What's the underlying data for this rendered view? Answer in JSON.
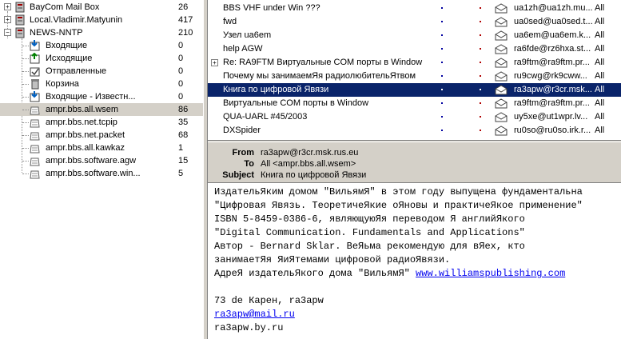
{
  "tree": [
    {
      "name": "BayCom Mail Box",
      "count": "26",
      "icon": "server-icon",
      "expand": "+"
    },
    {
      "name": "Local.Vladimir.Matyunin",
      "count": "417",
      "icon": "server-icon",
      "expand": "+"
    },
    {
      "name": "NEWS-NNTP",
      "count": "210",
      "icon": "server-icon",
      "expand": "−"
    },
    {
      "name": "Входящие",
      "count": "0",
      "icon": "inbox-icon"
    },
    {
      "name": "Исходящие",
      "count": "0",
      "icon": "outbox-icon"
    },
    {
      "name": "Отправленные",
      "count": "0",
      "icon": "sent-icon"
    },
    {
      "name": "Корзина",
      "count": "0",
      "icon": "trash-icon"
    },
    {
      "name": "Входящие - Известн...",
      "count": "0",
      "icon": "inbox-icon"
    },
    {
      "name": "ampr.bbs.all.wsem",
      "count": "86",
      "icon": "newsgroup-icon"
    },
    {
      "name": "ampr.bbs.net.tcpip",
      "count": "35",
      "icon": "newsgroup-icon"
    },
    {
      "name": "ampr.bbs.net.packet",
      "count": "68",
      "icon": "newsgroup-icon"
    },
    {
      "name": "ampr.bbs.all.kawkaz",
      "count": "1",
      "icon": "newsgroup-icon"
    },
    {
      "name": "ampr.bbs.software.agw",
      "count": "15",
      "icon": "newsgroup-icon"
    },
    {
      "name": "ampr.bbs.software.win...",
      "count": "5",
      "icon": "newsgroup-icon"
    }
  ],
  "messages": [
    {
      "subject": "BBS VHF under Win ???",
      "from": "ua1zh@ua1zh.mu...",
      "to": "All"
    },
    {
      "subject": "fwd",
      "from": "ua0sed@ua0sed.t...",
      "to": "All"
    },
    {
      "subject": "Узел ua6em",
      "from": "ua6em@ua6em.k...",
      "to": "All"
    },
    {
      "subject": "help AGW",
      "from": "ra6fde@rz6hxa.st...",
      "to": "All"
    },
    {
      "subject": "Re: RA9FTM Виртуальные COM порты в Window",
      "from": "ra9ftm@ra9ftm.pr...",
      "to": "All",
      "expand": "+"
    },
    {
      "subject": "Почему мы занимаемЯя радиолюбительЯтвом",
      "from": "ru9cwg@rk9cww...",
      "to": "All"
    },
    {
      "subject": "Книга по цифровой Явязи",
      "from": "ra3apw@r3cr.msk....",
      "to": "All",
      "selected": true
    },
    {
      "subject": "Виртуальные COM порты в Window",
      "from": "ra9ftm@ra9ftm.pr...",
      "to": "All"
    },
    {
      "subject": "QUA-UARL #45/2003",
      "from": "uy5xe@ut1wpr.lv...",
      "to": "All"
    },
    {
      "subject": "DXSpider",
      "from": "ru0so@ru0so.irk.r...",
      "to": "All"
    }
  ],
  "header": {
    "from_label": "From",
    "from_value": "ra3apw@r3cr.msk.rus.eu",
    "to_label": "To",
    "to_value": "All <ampr.bbs.all.wsem>",
    "subject_label": "Subject",
    "subject_value": "Книга по цифровой Явязи"
  },
  "body": {
    "line1": "ИздательЯким домом \"ВильямЯ\" в этом году выпущена фундаментальна",
    "line2": "\"Цифровая Явязь. ТеоретичеЯкие оЯновы и практичеЯкое применение\"",
    "line3": "ISBN 5-8459-0386-6, являющуюЯя переводом Я английЯкого",
    "line4": "\"Digital Communication. Fundamentals and Applications\"",
    "line5": "Автор - Bernard Sklar. ВеЯьма рекомендую для вЯех, кто",
    "line6": "занимаетЯя ЯиЯтемами цифровой радиоЯвязи.",
    "line7_text": "АдреЯ издательЯкого дома \"ВильямЯ\" ",
    "line7_link": "www.williamspublishing.com",
    "line9": "73 de Карен, ra3apw",
    "line10_link": "ra3apw@mail.ru",
    "line11": "ra3apw.by.ru"
  }
}
